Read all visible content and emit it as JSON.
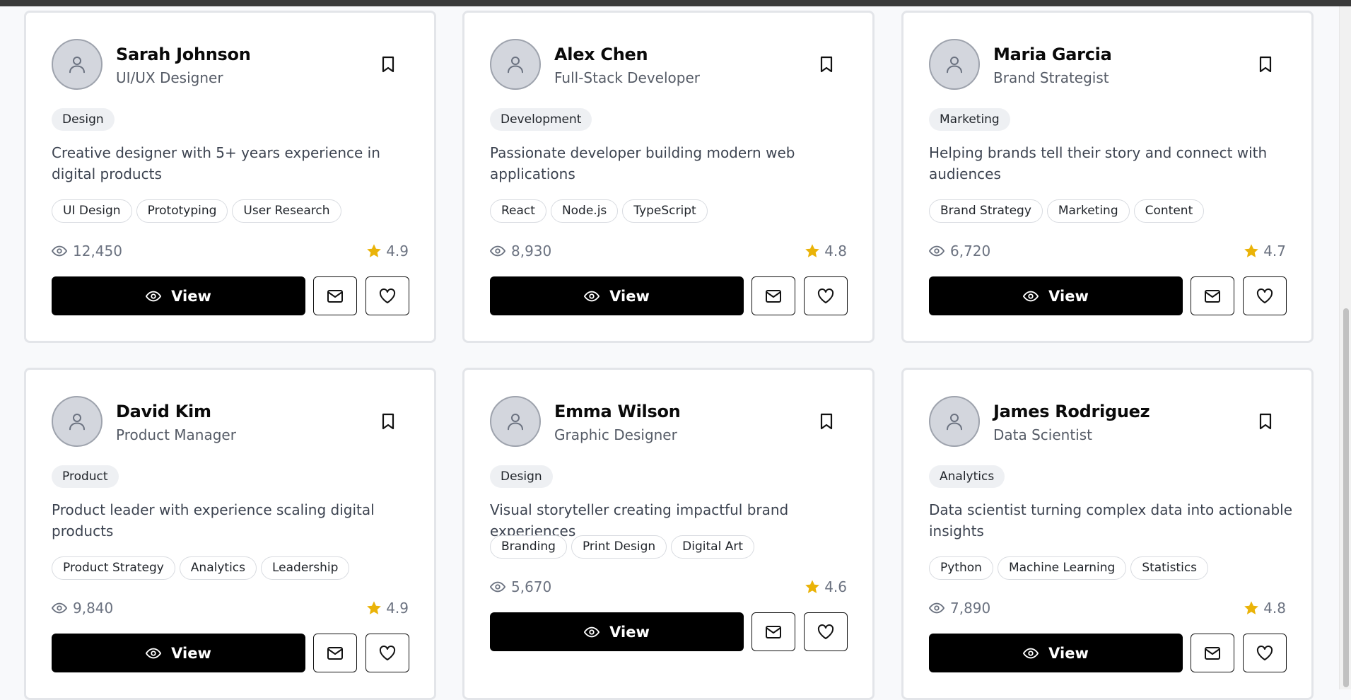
{
  "profiles": [
    {
      "name": "Sarah Johnson",
      "role": "UI/UX Designer",
      "category": "Design",
      "description": "Creative designer with 5+ years experience in digital products",
      "skills": [
        "UI Design",
        "Prototyping",
        "User Research"
      ],
      "views": "12,450",
      "rating": "4.9",
      "view_label": "View"
    },
    {
      "name": "Alex Chen",
      "role": "Full-Stack Developer",
      "category": "Development",
      "description": "Passionate developer building modern web applications",
      "skills": [
        "React",
        "Node.js",
        "TypeScript"
      ],
      "views": "8,930",
      "rating": "4.8",
      "view_label": "View"
    },
    {
      "name": "Maria Garcia",
      "role": "Brand Strategist",
      "category": "Marketing",
      "description": "Helping brands tell their story and connect with audiences",
      "skills": [
        "Brand Strategy",
        "Marketing",
        "Content"
      ],
      "views": "6,720",
      "rating": "4.7",
      "view_label": "View"
    },
    {
      "name": "David Kim",
      "role": "Product Manager",
      "category": "Product",
      "description": "Product leader with experience scaling digital products",
      "skills": [
        "Product Strategy",
        "Analytics",
        "Leadership"
      ],
      "views": "9,840",
      "rating": "4.9",
      "view_label": "View"
    },
    {
      "name": "Emma Wilson",
      "role": "Graphic Designer",
      "category": "Design",
      "description": "Visual storyteller creating impactful brand experiences",
      "skills": [
        "Branding",
        "Print Design",
        "Digital Art"
      ],
      "views": "5,670",
      "rating": "4.6",
      "view_label": "View"
    },
    {
      "name": "James Rodriguez",
      "role": "Data Scientist",
      "category": "Analytics",
      "description": "Data scientist turning complex data into actionable insights",
      "skills": [
        "Python",
        "Machine Learning",
        "Statistics"
      ],
      "views": "7,890",
      "rating": "4.8",
      "view_label": "View"
    }
  ],
  "colors": {
    "star": "#eab308",
    "button_bg": "#000000",
    "card_border": "#e3e5e9"
  },
  "icons": {
    "avatar": "user-icon",
    "bookmark": "bookmark-icon",
    "views": "eye-icon",
    "rating": "star-icon",
    "message": "mail-icon",
    "favorite": "heart-icon"
  }
}
